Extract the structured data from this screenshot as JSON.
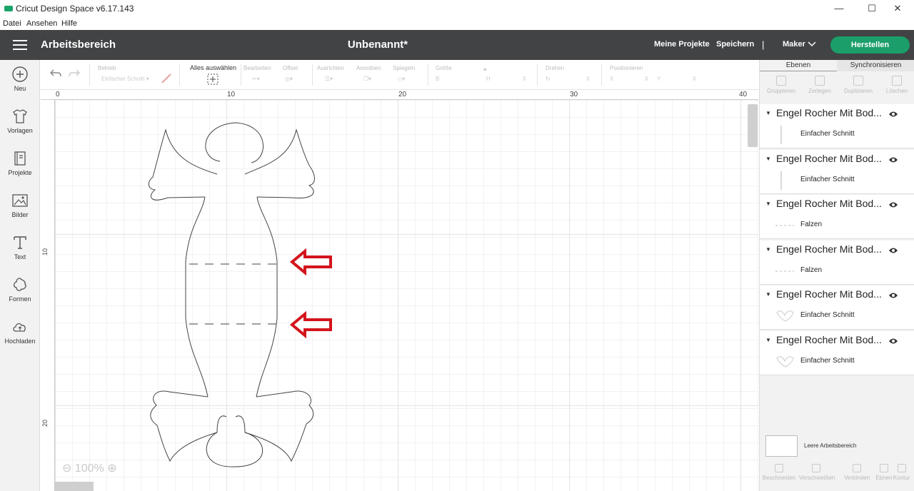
{
  "window": {
    "title": "Cricut Design Space  v6.17.143",
    "minimize": "—",
    "maximize": "☐",
    "close": "✕"
  },
  "menu": [
    "Datei",
    "Ansehen",
    "Hilfe"
  ],
  "header": {
    "workspace": "Arbeitsbereich",
    "document": "Unbenannt*",
    "my_projects": "Meine Projekte",
    "save": "Speichern",
    "separator": "|",
    "machine": "Maker",
    "make": "Herstellen",
    "colors": {
      "bar": "#414345",
      "make_button": "#1b9e6a"
    }
  },
  "sidebar": [
    {
      "label": "Neu",
      "icon": "plus-circle-icon"
    },
    {
      "label": "Vorlagen",
      "icon": "shirt-icon"
    },
    {
      "label": "Projekte",
      "icon": "book-icon"
    },
    {
      "label": "Bilder",
      "icon": "image-icon"
    },
    {
      "label": "Text",
      "icon": "text-icon"
    },
    {
      "label": "Formen",
      "icon": "shapes-icon"
    },
    {
      "label": "Hochladen",
      "icon": "cloud-upload-icon"
    }
  ],
  "toolbar": {
    "operation_label": "Betrieb",
    "operation_value": "Einfacher Schnitt ▾",
    "select_all": "Alles auswählen",
    "edit": "Bearbeiten",
    "offset": "Offset",
    "align": "Ausrichten",
    "arrange": "Anordnen",
    "mirror": "Spiegeln",
    "size": "Größe",
    "width_label": "B",
    "height_label": "H",
    "rotate": "Drehen",
    "position": "Positionieren",
    "x_label": "X",
    "y_label": "Y"
  },
  "canvas": {
    "ruler_top": [
      "0",
      "10",
      "20",
      "30",
      "40"
    ],
    "ruler_left": [
      "10",
      "20"
    ],
    "zoom": "100%"
  },
  "panel": {
    "tabs": [
      "Ebenen",
      "Synchronisieren"
    ],
    "actions": [
      "Gruppieren",
      "Zerlegen",
      "Duplizieren",
      "Löschen"
    ],
    "layers": [
      {
        "name": "Engel Rocher Mit Bod...",
        "sub": "Einfacher Schnitt",
        "thumb": "line"
      },
      {
        "name": "Engel Rocher Mit Bod...",
        "sub": "Einfacher Schnitt",
        "thumb": "line"
      },
      {
        "name": "Engel Rocher Mit Bod...",
        "sub": "Falzen",
        "thumb": "dash"
      },
      {
        "name": "Engel Rocher Mit Bod...",
        "sub": "Falzen",
        "thumb": "dash"
      },
      {
        "name": "Engel Rocher Mit Bod...",
        "sub": "Einfacher Schnitt",
        "thumb": "wing"
      },
      {
        "name": "Engel Rocher Mit Bod...",
        "sub": "Einfacher Schnitt",
        "thumb": "wing"
      }
    ],
    "blank_canvas": "Leere Arbeitsbereich",
    "bottom_actions": [
      "Beschneiden",
      "Verschweißen",
      "Verbinden",
      "Ebnen",
      "Kontur"
    ]
  }
}
